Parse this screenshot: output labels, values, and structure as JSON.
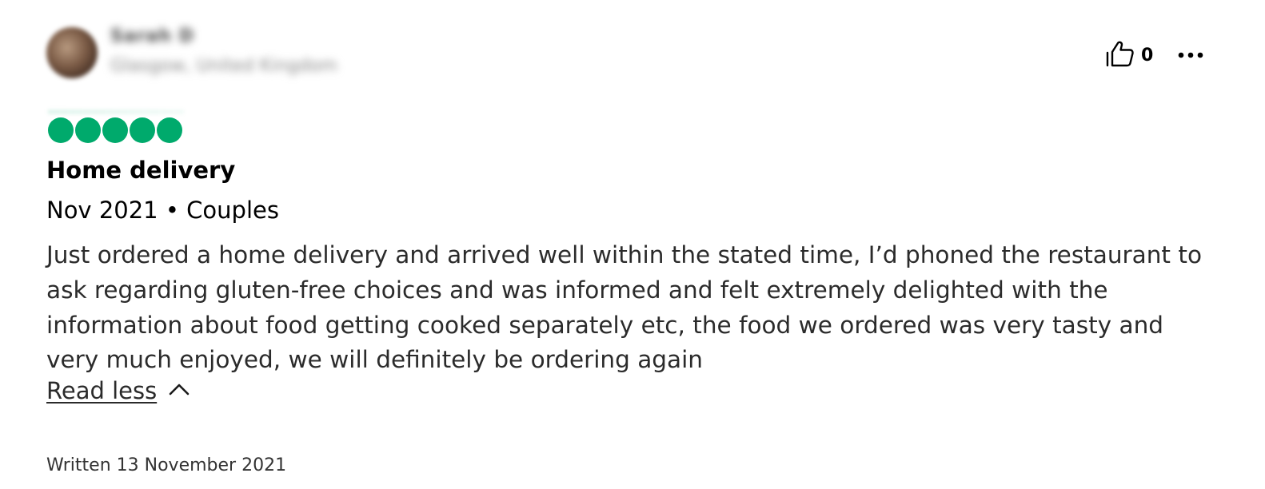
{
  "reviewer": {
    "name": "Sarah D",
    "meta": "Glasgow, United Kingdom"
  },
  "actions": {
    "helpful_count": "0",
    "helpful_icon": "thumbs-up-icon",
    "more_icon": "more-horizontal-icon"
  },
  "rating": {
    "value": 5,
    "max": 5,
    "color": "#00aa6c"
  },
  "review": {
    "title": "Home delivery",
    "visit_info": "Nov 2021 • Couples",
    "body": "Just ordered a home delivery and arrived well within the stated time, I’d phoned the restaurant to ask regarding gluten-free choices and was informed and felt extremely delighted with the information about food getting cooked separately etc, the food we ordered was very tasty and very much enjoyed, we will definitely be ordering again",
    "read_less_label": "Read less",
    "read_less_icon": "chevron-up-icon",
    "written_date": "Written 13 November 2021"
  }
}
